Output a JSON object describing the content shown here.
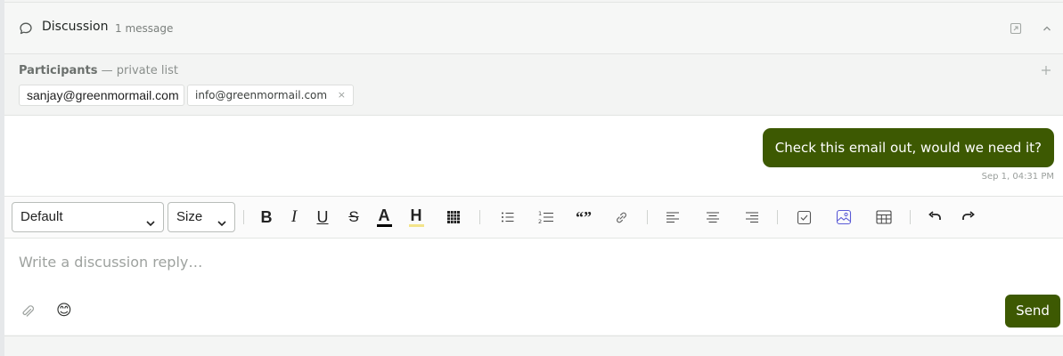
{
  "header": {
    "title": "Discussion",
    "count": "1 message",
    "icons": [
      "chat-bubble-icon",
      "expand-icon",
      "chevron-up-icon"
    ]
  },
  "participants": {
    "label": "Participants",
    "suffix": "— private list",
    "add_icon": "plus-icon",
    "chips": [
      {
        "email": "sanjay@greenmormail.com"
      },
      {
        "email": "info@greenmormail.com",
        "remove": "×"
      }
    ]
  },
  "messages": [
    {
      "text": "Check this email out, would we need it?",
      "timestamp": "Sep 1, 04:31 PM",
      "color": "#3d5902"
    }
  ],
  "toolbar": {
    "font_select": "Default",
    "size_select": "Size",
    "bold": "B",
    "italic": "I",
    "underline": "U",
    "strike": "S",
    "font_color": "A",
    "highlight": "H",
    "quote": "“”",
    "font_color_swatch": "#000000",
    "highlight_swatch": "#f3e48a"
  },
  "composer": {
    "placeholder": "Write a discussion reply…",
    "emoji": "😊",
    "send_label": "Send",
    "accent": "#3d5902"
  }
}
